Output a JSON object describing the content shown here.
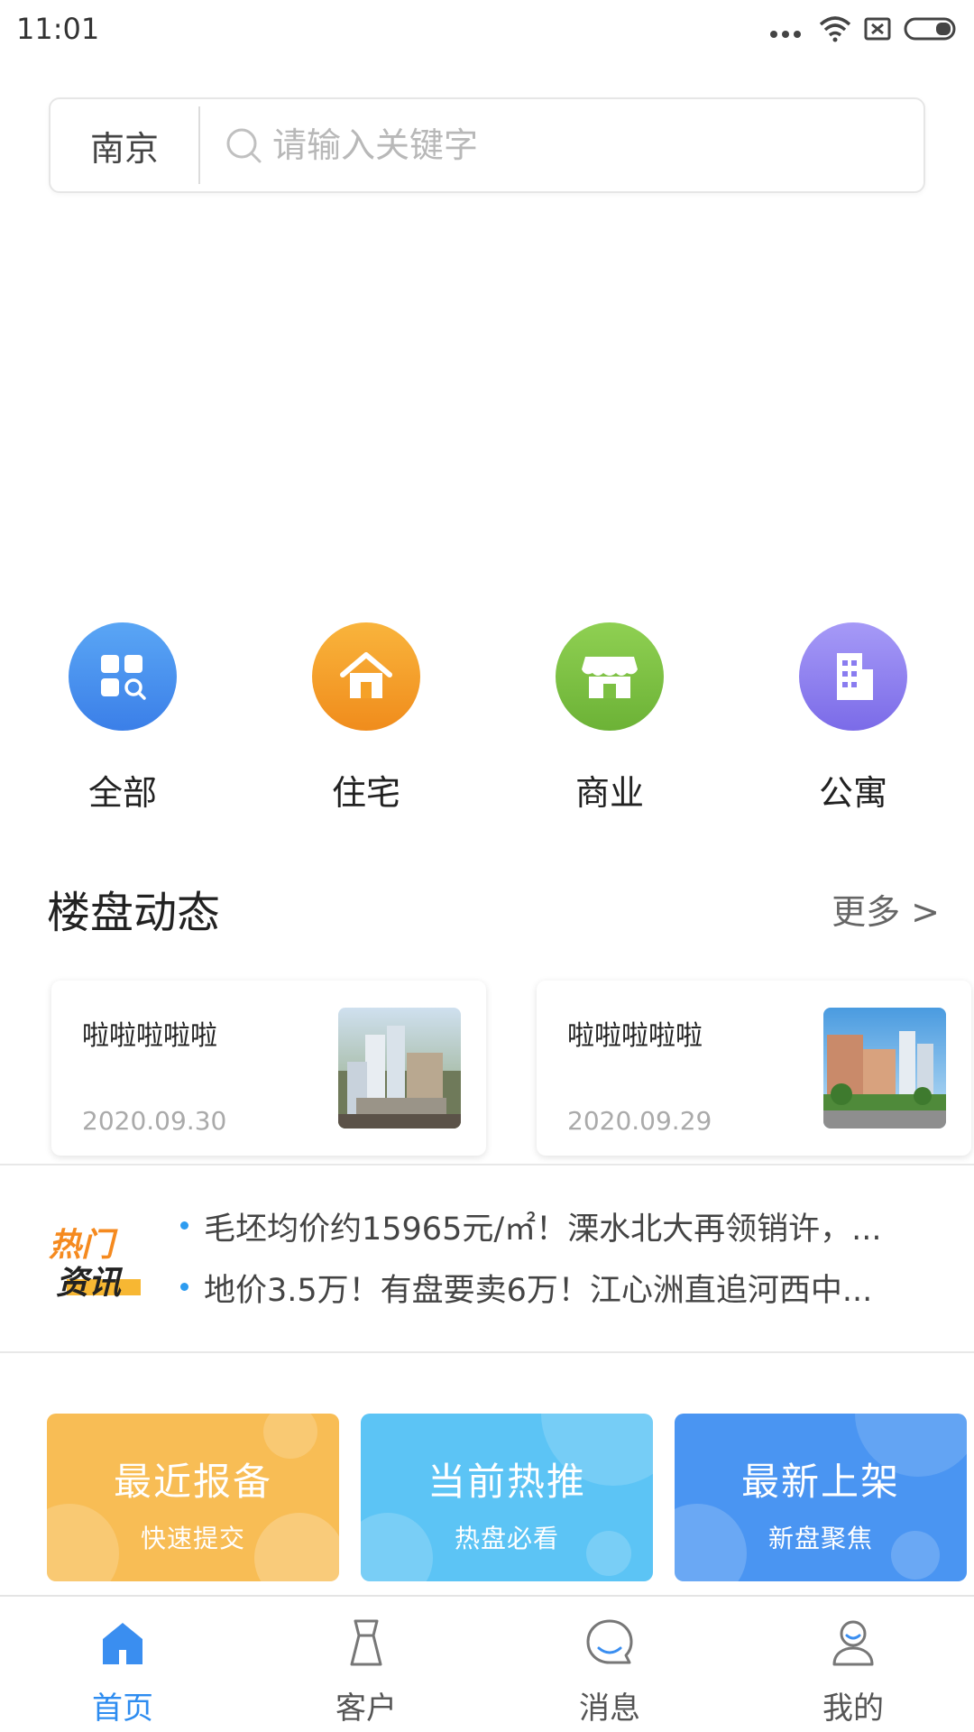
{
  "status_bar": {
    "time": "11:01"
  },
  "search": {
    "city": "南京",
    "placeholder": "请输入关键字"
  },
  "categories": [
    {
      "label": "全部",
      "icon": "grid-search-icon",
      "color": "#4a90f0"
    },
    {
      "label": "住宅",
      "icon": "house-icon",
      "color": "#f5a127"
    },
    {
      "label": "商业",
      "icon": "storefront-icon",
      "color": "#7cc043"
    },
    {
      "label": "公寓",
      "icon": "building-icon",
      "color": "#8a7cf0"
    }
  ],
  "updates": {
    "title": "楼盘动态",
    "more": "更多 >",
    "cards": [
      {
        "title": "啦啦啦啦啦",
        "date": "2020.09.30"
      },
      {
        "title": "啦啦啦啦啦",
        "date": "2020.09.29"
      }
    ]
  },
  "hot_news": {
    "logo_line1": "热门",
    "logo_line2": "资讯",
    "items": [
      "毛坯均价约15965元/㎡！溧水北大再领销许，...",
      "地价3.5万！有盘要卖6万！江心洲直追河西中..."
    ]
  },
  "promos": [
    {
      "title": "最近报备",
      "subtitle": "快速提交",
      "color": "#f8bd55"
    },
    {
      "title": "当前热推",
      "subtitle": "热盘必看",
      "color": "#5cc4f5"
    },
    {
      "title": "最新上架",
      "subtitle": "新盘聚焦",
      "color": "#4a95f2"
    }
  ],
  "tabs": [
    {
      "label": "首页",
      "active": true
    },
    {
      "label": "客户",
      "active": false
    },
    {
      "label": "消息",
      "active": false
    },
    {
      "label": "我的",
      "active": false
    }
  ],
  "colors": {
    "accent": "#2d8cf0",
    "news_dot": "#2d9cf0"
  }
}
